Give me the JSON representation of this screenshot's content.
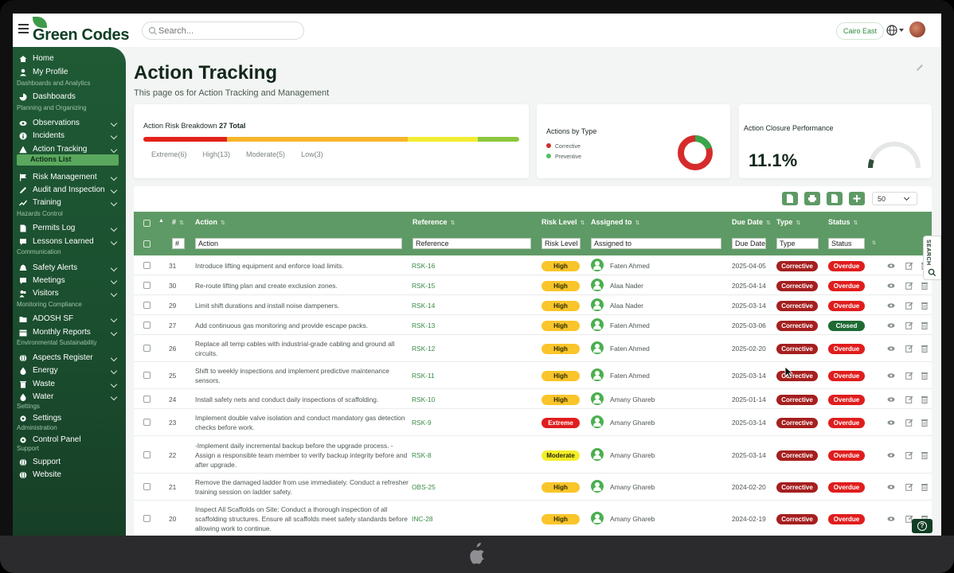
{
  "app": {
    "logo_text": "Green Codes"
  },
  "topbar": {
    "search_placeholder": "Search...",
    "location": "Cairo East"
  },
  "sidebar": {
    "items": [
      {
        "label": "Home",
        "icon": "home-icon"
      },
      {
        "label": "My Profile",
        "icon": "user-icon"
      },
      {
        "section": "Dashboards and Analytics"
      },
      {
        "label": "Dashboards",
        "icon": "chart-pie-icon"
      },
      {
        "section": "Planning and Organizing"
      },
      {
        "label": "Observations",
        "icon": "eye-icon"
      },
      {
        "label": "Incidents",
        "icon": "info-icon"
      },
      {
        "label": "Action Tracking",
        "icon": "warning-icon"
      },
      {
        "label": "Actions List",
        "active": true
      },
      {
        "label": "Risk Management",
        "icon": "flag-icon"
      },
      {
        "label": "Audit and Inspection",
        "icon": "pencil-icon"
      },
      {
        "label": "Training",
        "icon": "trend-icon"
      },
      {
        "section": "Hazards Control"
      },
      {
        "label": "Permits Log",
        "icon": "doc-icon"
      },
      {
        "label": "Lessons Learned",
        "icon": "chat-icon"
      },
      {
        "section": "Communication"
      },
      {
        "label": "Safety Alerts",
        "icon": "bell-icon"
      },
      {
        "label": "Meetings",
        "icon": "chat-icon"
      },
      {
        "label": "Visitors",
        "icon": "users-icon"
      },
      {
        "section": "Monitoring Compliance"
      },
      {
        "label": "ADOSH SF",
        "icon": "folder-icon"
      },
      {
        "label": "Monthly Reports",
        "icon": "calendar-icon"
      },
      {
        "section": "Environmental Sustainability"
      },
      {
        "label": "Aspects Register",
        "icon": "globe-icon"
      },
      {
        "label": "Energy",
        "icon": "drop-icon"
      },
      {
        "label": "Waste",
        "icon": "trash-icon"
      },
      {
        "label": "Water",
        "icon": "drop-icon"
      },
      {
        "section": "Settings"
      },
      {
        "label": "Settings",
        "icon": "gear-icon"
      },
      {
        "section": "Administration"
      },
      {
        "label": "Control Panel",
        "icon": "gear-icon"
      },
      {
        "section": "Support"
      },
      {
        "label": "Support",
        "icon": "globe-icon"
      },
      {
        "label": "Website",
        "icon": "globe-icon"
      }
    ]
  },
  "page": {
    "title": "Action Tracking",
    "subtitle": "This page os for Action Tracking and Management"
  },
  "risk_card": {
    "title": "Action Risk Breakdown",
    "total": "27 Total",
    "segments": [
      {
        "label": "Extreme(6)",
        "value": 6,
        "color": "#e3221a"
      },
      {
        "label": "High(13)",
        "value": 13,
        "color": "#f7b52b"
      },
      {
        "label": "Moderate(5)",
        "value": 5,
        "color": "#f2ec33"
      },
      {
        "label": "Low(3)",
        "value": 3,
        "color": "#8cc63f"
      }
    ]
  },
  "type_card": {
    "title": "Actions by Type",
    "legend": [
      {
        "label": "Corrective",
        "color": "#d62b2b"
      },
      {
        "label": "Preventive",
        "color": "#4fc15d"
      }
    ]
  },
  "closure_card": {
    "title": "Action Closure Performance",
    "value": "11.1%",
    "fraction": 0.111
  },
  "toolbar": {
    "page_size": "50"
  },
  "table": {
    "headers": {
      "num": "#",
      "action": "Action",
      "reference": "Reference",
      "risk": "Risk Level",
      "assigned": "Assigned to",
      "due": "Due Date",
      "type": "Type",
      "status": "Status"
    },
    "filters": {
      "num": "#",
      "action": "Action",
      "reference": "Reference",
      "risk": "Risk Level",
      "assigned": "Assigned to",
      "due": "Due Date",
      "type": "Type",
      "status": "Status"
    },
    "rows": [
      {
        "num": "31",
        "action": "Introduce lifting equipment and enforce load limits.",
        "ref": "RSK-16",
        "risk": "High",
        "assigned": "Faten Ahmed",
        "due": "2025-04-05",
        "type": "Corrective",
        "status": "Overdue"
      },
      {
        "num": "30",
        "action": "Re-route lifting plan and create exclusion zones.",
        "ref": "RSK-15",
        "risk": "High",
        "assigned": "Alaa Nader",
        "due": "2025-04-14",
        "type": "Corrective",
        "status": "Overdue"
      },
      {
        "num": "29",
        "action": "Limit shift durations and install noise dampeners.",
        "ref": "RSK-14",
        "risk": "High",
        "assigned": "Alaa Nader",
        "due": "2025-03-14",
        "type": "Corrective",
        "status": "Overdue"
      },
      {
        "num": "27",
        "action": "Add continuous gas monitoring and provide escape packs.",
        "ref": "RSK-13",
        "risk": "High",
        "assigned": "Faten Ahmed",
        "due": "2025-03-06",
        "type": "Corrective",
        "status": "Closed"
      },
      {
        "num": "26",
        "action": "Replace all temp cables with industrial-grade cabling and ground all circuits.",
        "ref": "RSK-12",
        "risk": "High",
        "assigned": "Faten Ahmed",
        "due": "2025-02-20",
        "type": "Corrective",
        "status": "Overdue"
      },
      {
        "num": "25",
        "action": "Shift to weekly inspections and implement predictive maintenance sensors.",
        "ref": "RSK-11",
        "risk": "High",
        "assigned": "Faten Ahmed",
        "due": "2025-03-14",
        "type": "Corrective",
        "status": "Overdue"
      },
      {
        "num": "24",
        "action": "Install safety nets and conduct daily inspections of scaffolding.",
        "ref": "RSK-10",
        "risk": "High",
        "assigned": "Amany Ghareb",
        "due": "2025-01-14",
        "type": "Corrective",
        "status": "Overdue"
      },
      {
        "num": "23",
        "action": "Implement double valve isolation and conduct mandatory gas detection checks before work.",
        "ref": "RSK-9",
        "risk": "Extreme",
        "assigned": "Amany Ghareb",
        "due": "2025-03-14",
        "type": "Corrective",
        "status": "Overdue"
      },
      {
        "num": "22",
        "action": "-Implement daily incremental backup before the upgrade process. -Assign a responsible team member to verify backup integrity before and after upgrade.",
        "ref": "RSK-8",
        "risk": "Moderate",
        "assigned": "Amany Ghareb",
        "due": "2025-03-14",
        "type": "Corrective",
        "status": "Overdue"
      },
      {
        "num": "21",
        "action": "Remove the damaged ladder from use immediately. Conduct a refresher training session on ladder safety.",
        "ref": "OBS-25",
        "risk": "High",
        "assigned": "Amany Ghareb",
        "due": "2024-02-20",
        "type": "Corrective",
        "status": "Overdue"
      },
      {
        "num": "20",
        "action": "Inspect All Scaffolds on Site: Conduct a thorough inspection of all scaffolding structures. Ensure all scaffolds meet safety standards before allowing work to continue.",
        "ref": "INC-28",
        "risk": "High",
        "assigned": "Amany Ghareb",
        "due": "2024-02-19",
        "type": "Corrective",
        "status": "Overdue"
      }
    ]
  },
  "side_tab": {
    "label": "SEARCH"
  },
  "help": {
    "label": "?"
  }
}
